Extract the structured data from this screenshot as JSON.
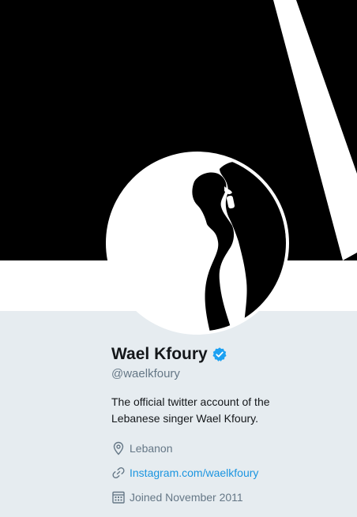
{
  "profile": {
    "display_name": "Wael Kfoury",
    "handle": "@waelkfoury",
    "bio": "The official twitter account of the Lebanese singer Wael Kfoury.",
    "location": "Lebanon",
    "website": "Instagram.com/waelkfoury",
    "joined": "Joined November 2011"
  },
  "icons": {
    "verified": "verified-badge-icon",
    "location": "location-pin-icon",
    "website": "link-icon",
    "joined": "calendar-icon"
  },
  "colors": {
    "accent": "#1b95e0",
    "verified": "#1da1f2",
    "text_primary": "#14171a",
    "text_secondary": "#657786",
    "background": "#e6ecf0",
    "banner": "#000000"
  }
}
